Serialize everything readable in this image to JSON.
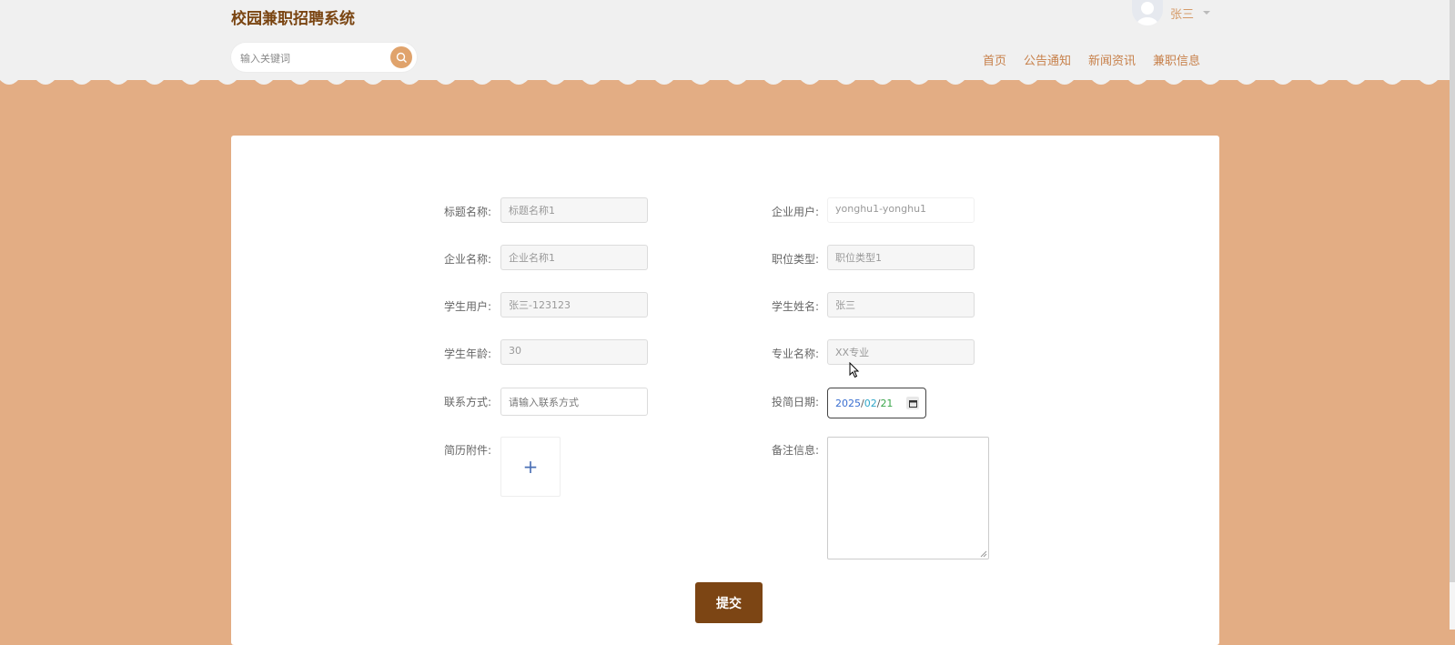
{
  "header": {
    "site_title": "校园兼职招聘系统",
    "search_placeholder": "输入关键词",
    "user_name": "张三",
    "nav": [
      "首页",
      "公告通知",
      "新闻资讯",
      "兼职信息"
    ]
  },
  "form": {
    "title_label": "标题名称:",
    "title_value": "标题名称1",
    "enterprise_user_label": "企业用户:",
    "enterprise_user_value": "yonghu1-yonghu1",
    "company_label": "企业名称:",
    "company_value": "企业名称1",
    "position_label": "职位类型:",
    "position_value": "职位类型1",
    "student_user_label": "学生用户:",
    "student_user_value": "张三-123123",
    "student_name_label": "学生姓名:",
    "student_name_value": "张三",
    "age_label": "学生年龄:",
    "age_value": "30",
    "major_label": "专业名称:",
    "major_value": "XX专业",
    "contact_label": "联系方式:",
    "contact_placeholder": "请输入联系方式",
    "date_label": "投简日期:",
    "date_year": "2025",
    "date_month": "02",
    "date_day": "21",
    "resume_label": "简历附件:",
    "remark_label": "备注信息:",
    "submit_label": "提交"
  }
}
